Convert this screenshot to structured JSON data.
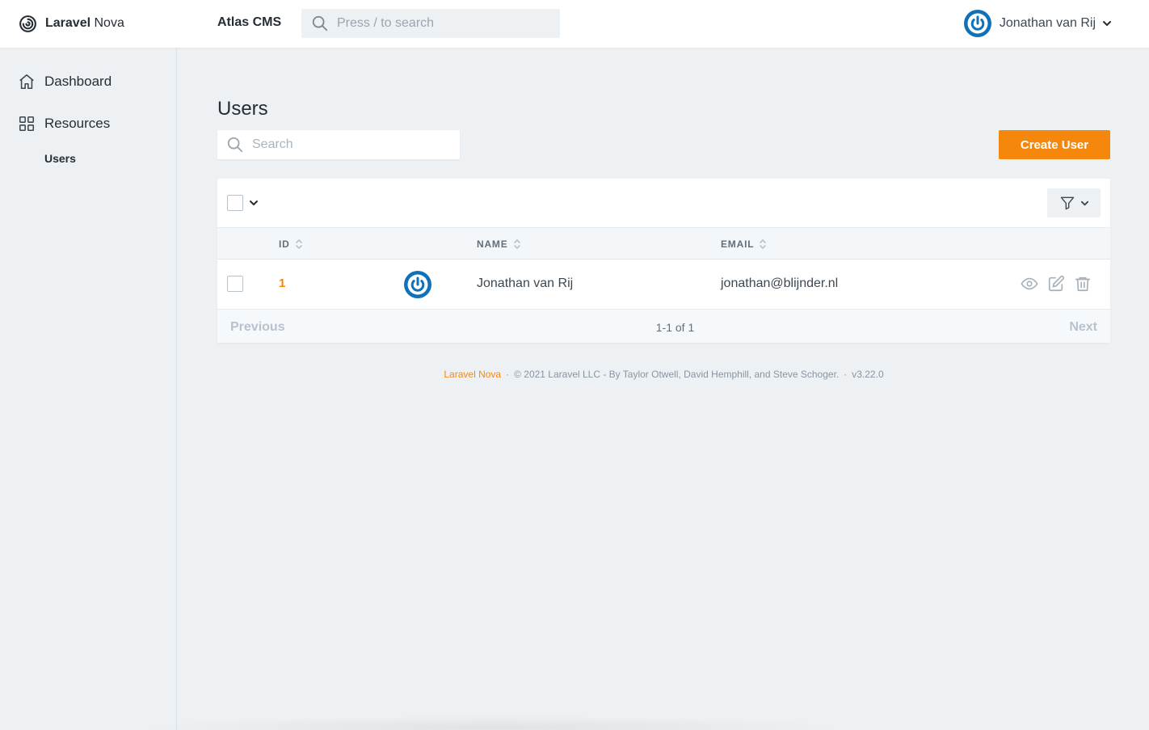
{
  "header": {
    "brand_bold": "Laravel",
    "brand_light": "Nova",
    "app_name": "Atlas CMS",
    "search_placeholder": "Press / to search",
    "user_name": "Jonathan van Rij"
  },
  "sidebar": {
    "dashboard_label": "Dashboard",
    "resources_label": "Resources",
    "resource_items": [
      "Users"
    ]
  },
  "main": {
    "title": "Users",
    "search_placeholder": "Search",
    "create_label": "Create User",
    "columns": {
      "id": "ID",
      "name": "NAME",
      "email": "EMAIL"
    },
    "rows": [
      {
        "id": "1",
        "name": "Jonathan van Rij",
        "email": "jonathan@blijnder.nl"
      }
    ],
    "pagination": {
      "previous": "Previous",
      "status": "1-1 of 1",
      "next": "Next"
    }
  },
  "footer": {
    "brand": "Laravel Nova",
    "copyright": "© 2021 Laravel LLC - By Taylor Otwell, David Hemphill, and Steve Schoger.",
    "version": "v3.22.0",
    "separator": "·"
  },
  "colors": {
    "accent": "#f5880c",
    "avatar_blue": "#1171b8",
    "page_bg": "#eef1f4"
  },
  "icons": [
    "nova-logo-icon",
    "search-icon",
    "avatar-power-icon",
    "chevron-down-icon",
    "home-icon",
    "grid-icon",
    "filter-icon",
    "sort-icon",
    "eye-icon",
    "edit-icon",
    "trash-icon"
  ]
}
